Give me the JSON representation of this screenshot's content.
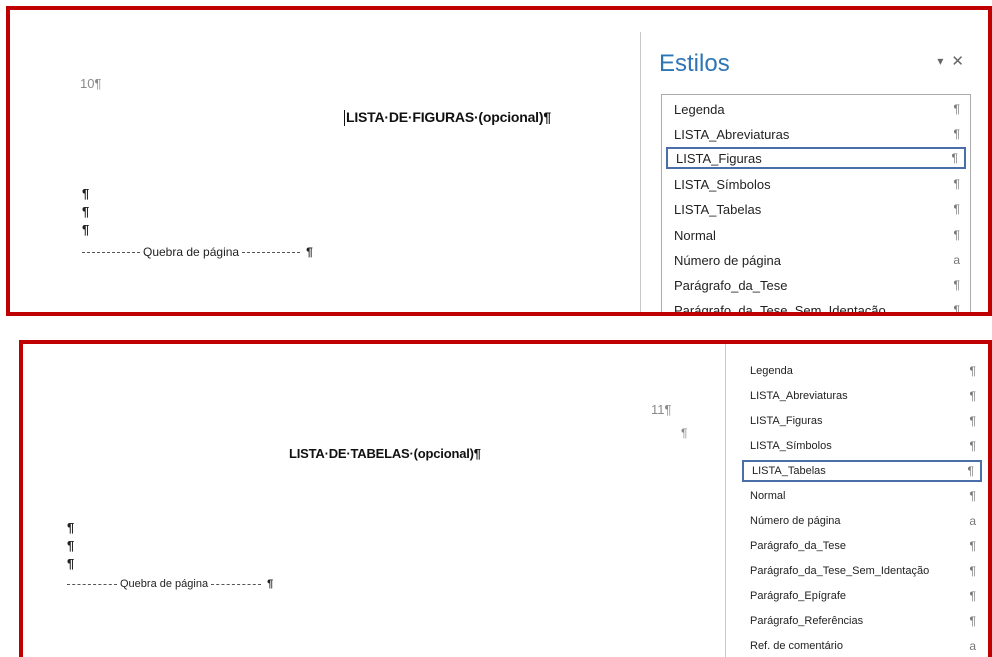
{
  "top": {
    "page_number": "10¶",
    "heading": "LISTA·DE·FIGURAS·(opcional)¶",
    "empty_paragraphs": [
      "¶",
      "¶",
      "¶"
    ],
    "page_break_label": "Quebra de página",
    "page_break_mark": "¶",
    "styles_pane": {
      "title": "Estilos",
      "dropdown_icon": "▾",
      "close_icon": "✕",
      "items": [
        {
          "label": "Legenda",
          "symbol": "¶"
        },
        {
          "label": "LISTA_Abreviaturas",
          "symbol": "¶"
        },
        {
          "label": "LISTA_Figuras",
          "symbol": "¶"
        },
        {
          "label": "LISTA_Símbolos",
          "symbol": "¶"
        },
        {
          "label": "LISTA_Tabelas",
          "symbol": "¶"
        },
        {
          "label": "Normal",
          "symbol": "¶"
        },
        {
          "label": "Número de página",
          "symbol": "a"
        },
        {
          "label": "Parágrafo_da_Tese",
          "symbol": "¶"
        },
        {
          "label": "Parágrafo_da_Tese_Sem_Identação",
          "symbol": "¶"
        }
      ],
      "selected": "LISTA_Figuras"
    }
  },
  "bottom": {
    "page_number": "11¶",
    "page_number_mark": "¶",
    "heading": "LISTA·DE·TABELAS·(opcional)¶",
    "empty_paragraphs": [
      "¶",
      "¶",
      "¶"
    ],
    "page_break_label": "Quebra de página",
    "page_break_mark": "¶",
    "styles_pane": {
      "items": [
        {
          "label": "Legenda",
          "symbol": "¶"
        },
        {
          "label": "LISTA_Abreviaturas",
          "symbol": "¶"
        },
        {
          "label": "LISTA_Figuras",
          "symbol": "¶"
        },
        {
          "label": "LISTA_Símbolos",
          "symbol": "¶"
        },
        {
          "label": "LISTA_Tabelas",
          "symbol": "¶"
        },
        {
          "label": "Normal",
          "symbol": "¶"
        },
        {
          "label": "Número de página",
          "symbol": "a"
        },
        {
          "label": "Parágrafo_da_Tese",
          "symbol": "¶"
        },
        {
          "label": "Parágrafo_da_Tese_Sem_Identação",
          "symbol": "¶"
        },
        {
          "label": "Parágrafo_Epígrafe",
          "symbol": "¶"
        },
        {
          "label": "Parágrafo_Referências",
          "symbol": "¶"
        },
        {
          "label": "Ref. de comentário",
          "symbol": "a"
        }
      ],
      "selected": "LISTA_Tabelas"
    }
  },
  "colors": {
    "frame_border": "#c00000",
    "pane_title": "#2e75b6",
    "selection_border": "#4a6fa8"
  }
}
